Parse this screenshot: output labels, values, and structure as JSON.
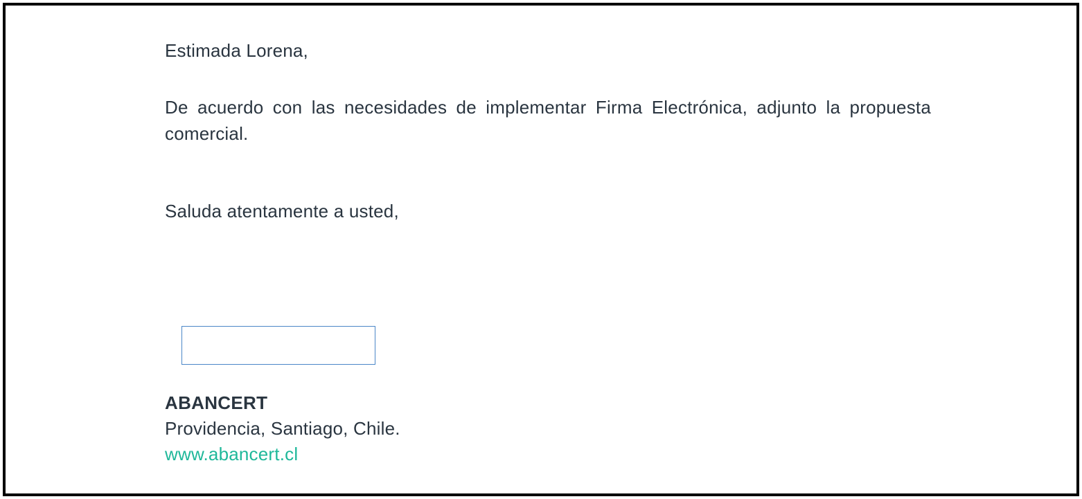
{
  "letter": {
    "greeting": "Estimada Lorena,",
    "body": "De acuerdo con las necesidades de implementar Firma Electrónica, adjunto la propuesta comercial.",
    "closing": "Saluda atentamente a usted,",
    "signature": {
      "company": "ABANCERT",
      "address": "Providencia, Santiago, Chile.",
      "website": "www.abancert.cl"
    }
  }
}
